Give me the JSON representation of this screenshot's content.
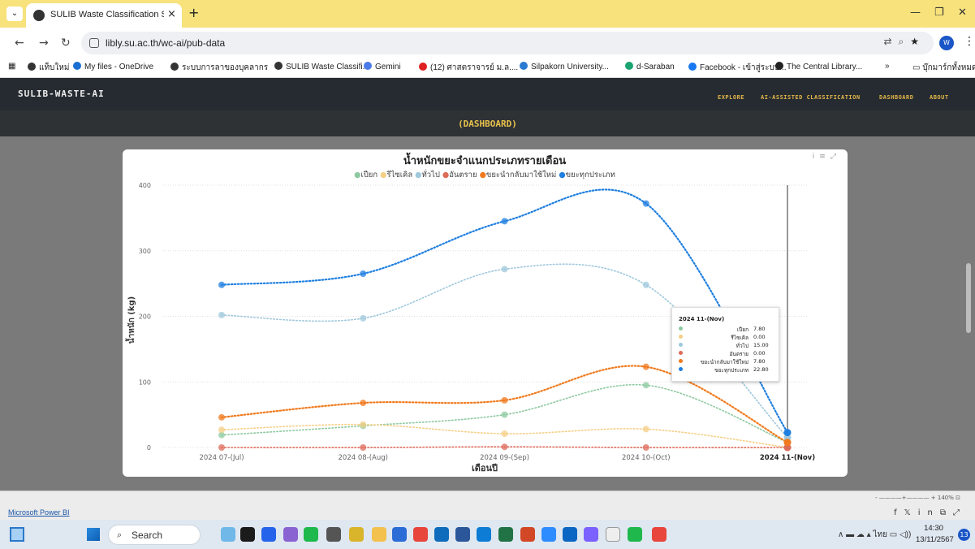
{
  "browser": {
    "tab_title": "SULIB Waste Classification Syste",
    "url": "libly.su.ac.th/wc-ai/pub-data",
    "profile_letter": "W",
    "bookmarks": [
      {
        "label": "แท็บใหม่",
        "color": "#333333"
      },
      {
        "label": "My files - OneDrive",
        "color": "#1a6fd1"
      },
      {
        "label": "ระบบการลาของบุคลากร",
        "color": "#333333"
      },
      {
        "label": "SULIB Waste Classifi...",
        "color": "#333333"
      },
      {
        "label": "Gemini",
        "color": "#4b7be8"
      },
      {
        "label": "(12) ศาสตราจารย์ ม.ล....",
        "color": "#e02020"
      },
      {
        "label": "Silpakorn University...",
        "color": "#2a7ad1"
      },
      {
        "label": "d-Saraban",
        "color": "#1aa36f"
      },
      {
        "label": "Facebook - เข้าสู่ระบบ...",
        "color": "#1877f2"
      },
      {
        "label": "The Central Library...",
        "color": "#222222"
      },
      {
        "label": "»",
        "color": "#ffffff"
      },
      {
        "label": "บุ๊กมาร์กทั้งหมด",
        "color": "#ffffff"
      }
    ]
  },
  "app": {
    "logo": "SULIB-WASTE-AI",
    "nav": [
      "EXPLORE",
      "AI-ASSISTED CLASSIFICATION",
      "DASHBOARD",
      "ABOUT"
    ],
    "page_heading": "(DASHBOARD)"
  },
  "chart_data": {
    "type": "line",
    "title": "น้ำหนักขยะจำแนกประเภทรายเดือน",
    "xlabel": "เดือนปี",
    "ylabel": "น้ำหนัก (kg)",
    "ylim": [
      0,
      400
    ],
    "yticks": [
      0,
      100,
      200,
      300,
      400
    ],
    "categories": [
      "2024 07-(Jul)",
      "2024 08-(Aug)",
      "2024 09-(Sep)",
      "2024 10-(Oct)",
      "2024 11-(Nov)"
    ],
    "grid": true,
    "legend_position": "top",
    "series": [
      {
        "name": "เปียก",
        "color": "#8dc9a0",
        "values": [
          19,
          33,
          50,
          95,
          7.8
        ]
      },
      {
        "name": "รีไซเคิล",
        "color": "#f5cf86",
        "values": [
          27,
          35,
          21,
          28,
          0
        ]
      },
      {
        "name": "ทั่วไป",
        "color": "#9fc8dc",
        "values": [
          202,
          197,
          272,
          248,
          15
        ]
      },
      {
        "name": "อันตราย",
        "color": "#dd6b5a",
        "values": [
          0,
          0,
          1,
          0,
          0
        ]
      },
      {
        "name": "ขยะนำกลับมาใช้ใหม่",
        "color": "#f07a1d",
        "values": [
          46,
          68,
          72,
          123,
          7.8
        ]
      },
      {
        "name": "ขยะทุกประเภท",
        "color": "#1f7fe0",
        "values": [
          248,
          265,
          345,
          372,
          22.8
        ]
      }
    ],
    "tooltip": {
      "title": "2024 11-(Nov)",
      "rows": [
        {
          "label": "เปียก",
          "value": "7.80"
        },
        {
          "label": "รีไซเคิล",
          "value": "0.00"
        },
        {
          "label": "ทั่วไป",
          "value": "15.00"
        },
        {
          "label": "อันตราย",
          "value": "0.00"
        },
        {
          "label": "ขยะนำกลับมาใช้ใหม่",
          "value": "7.80"
        },
        {
          "label": "ขยะทุกประเภท",
          "value": "22.80"
        }
      ]
    }
  },
  "powerbi": {
    "link": "Microsoft Power BI",
    "zoom": "140%"
  },
  "taskbar": {
    "search": "Search",
    "language": "ไทย",
    "time": "14:30",
    "date": "13/11/2567",
    "notifications": "13"
  }
}
